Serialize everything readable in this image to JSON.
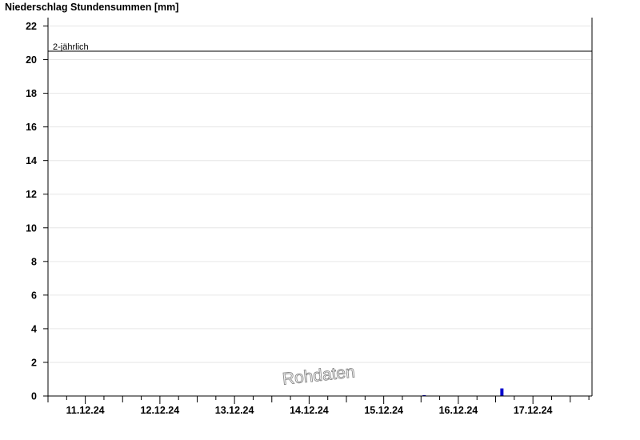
{
  "chart_data": {
    "type": "bar",
    "title": "Niederschlag Stundensummen [mm]",
    "xlabel": "",
    "ylabel": "",
    "ylim": [
      0,
      22.5
    ],
    "yticks": [
      0,
      2,
      4,
      6,
      8,
      10,
      12,
      14,
      16,
      18,
      20,
      22
    ],
    "grid": "horizontal",
    "xlim": [
      "2024-12-10T12:00",
      "2024-12-17T19:00"
    ],
    "xticks": [
      {
        "label": "11.12.24",
        "date": "2024-12-11T00:00"
      },
      {
        "label": "12.12.24",
        "date": "2024-12-12T00:00"
      },
      {
        "label": "13.12.24",
        "date": "2024-12-13T00:00"
      },
      {
        "label": "14.12.24",
        "date": "2024-12-14T00:00"
      },
      {
        "label": "15.12.24",
        "date": "2024-12-15T00:00"
      },
      {
        "label": "16.12.24",
        "date": "2024-12-16T00:00"
      },
      {
        "label": "17.12.24",
        "date": "2024-12-17T00:00"
      }
    ],
    "series": [
      {
        "color": "#0000cc",
        "points": [
          {
            "x": "2024-12-15T13:00",
            "y": 0.05
          },
          {
            "x": "2024-12-16T14:00",
            "y": 0.45
          }
        ]
      }
    ],
    "reference_lines": [
      {
        "label": "2-jährlich",
        "value": 20.5,
        "color": "#000000"
      }
    ],
    "watermark": "Rohdaten"
  }
}
